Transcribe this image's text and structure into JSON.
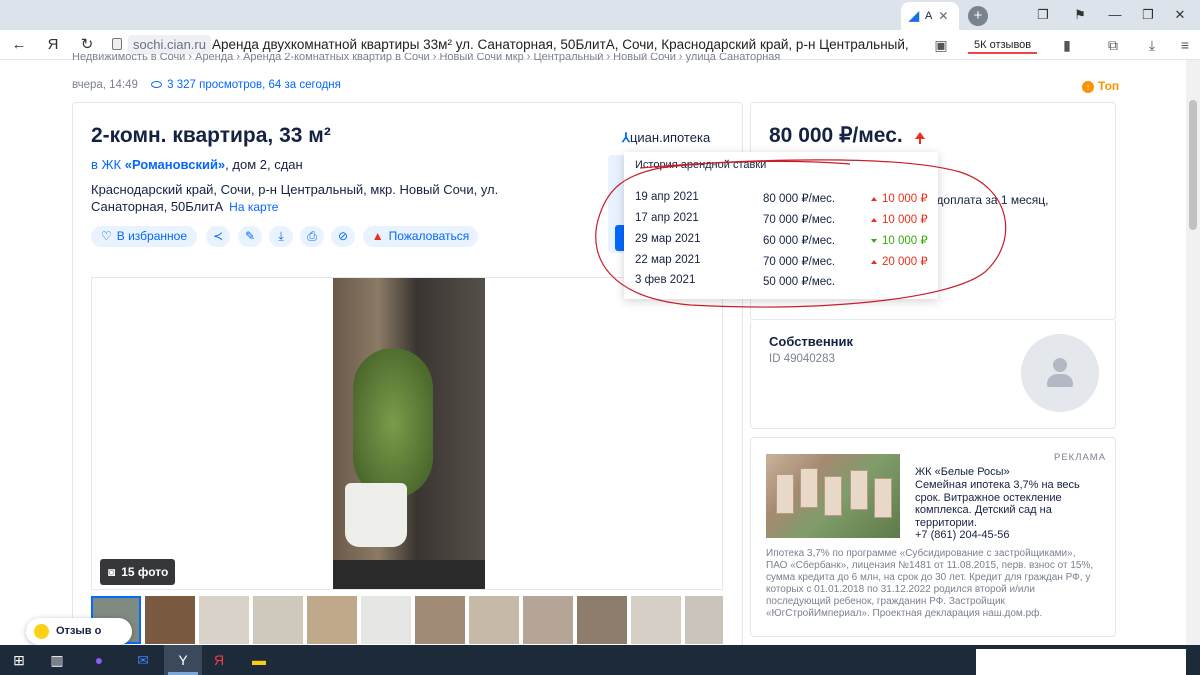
{
  "browser": {
    "active_tab_label": "А",
    "url": "sochi.cian.ru",
    "page_title": "Аренда двухкомнатной квартиры 33м² ул. Санаторная, 50БлитА, Сочи, Краснодарский край, р-н Центральный, мкр. Н...",
    "reviews": "5К отзывов"
  },
  "page": {
    "breadcrumbs": "Недвижимость в Сочи  ›  Аренда  ›  Аренда 2-комнатных квартир в Сочи  ›  Новый Сочи мкр  ›  Центральный  ›  Новый Сочи  ›  улица Санаторная",
    "posted": "вчера, 14:49",
    "views": "3 327 просмотров, 64 за сегодня",
    "top_badge": "Топ"
  },
  "listing": {
    "title": "2-комн. квартира, 33 м²",
    "logo_part1": "циан",
    "logo_part2": ".ипотека",
    "complex_prefix": "в ЖК",
    "complex_name": "«Романовский»",
    "complex_suffix": ", дом 2, сдан",
    "address": "Краснодарский край, Сочи, р-н Центральный, мкр. Новый Сочи, ул. Санаторная, 50БлитА",
    "map_link": "На карте",
    "actions": {
      "favorite": "В избранное",
      "complain": "Пожаловаться"
    },
    "photo_count": "15 фото"
  },
  "sidebar": {
    "price": "80 000 ₽/мес.",
    "prepayment_fragment": "едоплата за 1 месяц,",
    "owner_title": "Собственник",
    "owner_id": "ID 49040283"
  },
  "price_history": {
    "heading": "История арендной ставки",
    "rows": [
      {
        "date": "19 апр 2021",
        "price": "80 000 ₽/мес.",
        "change": "10 000 ₽",
        "direction": "up"
      },
      {
        "date": "17 апр 2021",
        "price": "70 000 ₽/мес.",
        "change": "10 000 ₽",
        "direction": "up"
      },
      {
        "date": "29 мар 2021",
        "price": "60 000 ₽/мес.",
        "change": "10 000 ₽",
        "direction": "down"
      },
      {
        "date": "22 мар 2021",
        "price": "70 000 ₽/мес.",
        "change": "20 000 ₽",
        "direction": "up"
      },
      {
        "date": "3 фев 2021",
        "price": "50 000 ₽/мес.",
        "change": "",
        "direction": ""
      }
    ]
  },
  "ad": {
    "label": "РЕКЛАМА",
    "title": "ЖК «Белые Росы»",
    "text": "Семейная ипотека 3,7% на весь срок. Витражное остекление комплекса. Детский сад на территории.",
    "phone": "+7 (861) 204-45-56",
    "fine_print": "Ипотека 3,7% по программе «Субсидирование с застройщиками», ПАО «Сбербанк», лицензия №1481 от 11.08.2015, перв. взнос от 15%, сумма кредита до 6 млн, на срок до 30 лет. Кредит для граждан РФ, у которых с 01.01.2018 по 31.12.2022 родился второй и/или последующий ребенок, гражданин РФ. Застройщик «ЮгСтройИмпериал». Проектная декларация наш.дом.рф."
  },
  "feedback_widget": "Отзыв о сайте",
  "colors": {
    "accent": "#0468ff",
    "price_up": "#e8301d",
    "price_down": "#34ac0a",
    "top_badge": "#ff9100",
    "annotation_circle": "#c81e2a"
  }
}
